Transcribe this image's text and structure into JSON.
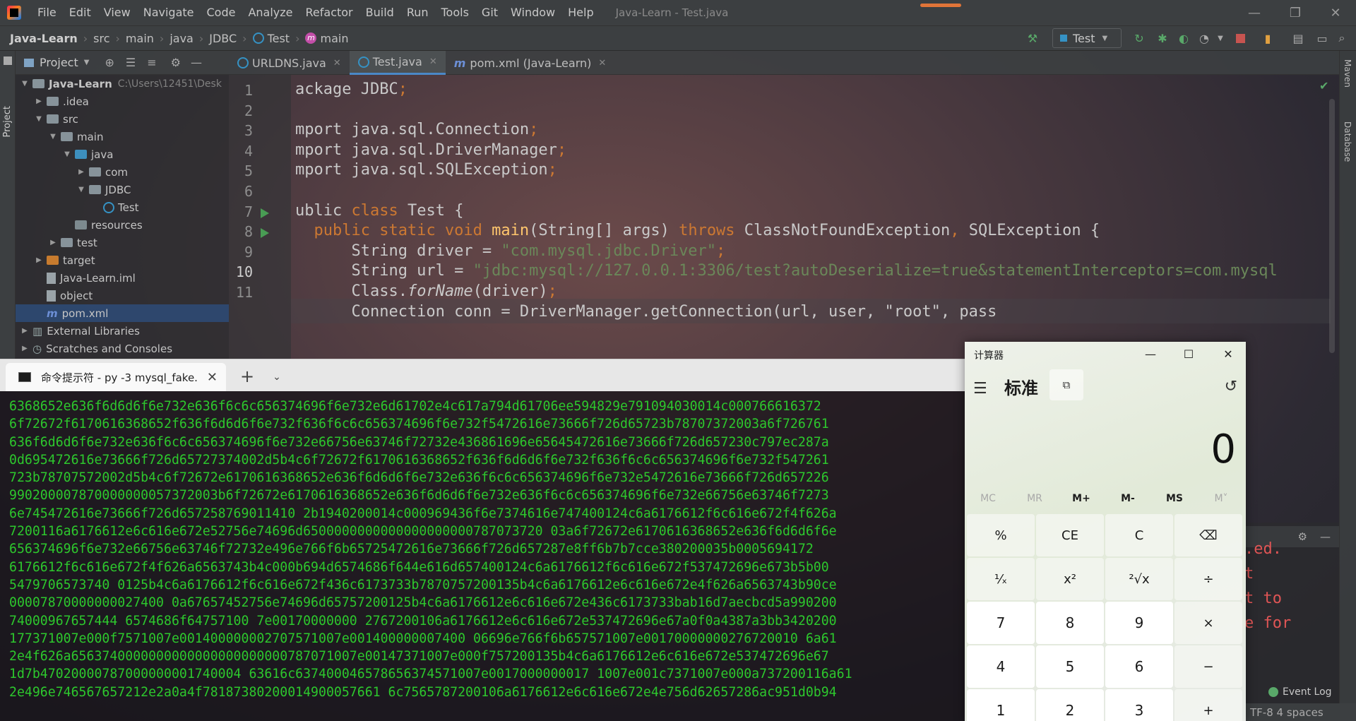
{
  "menubar": {
    "items": [
      "File",
      "Edit",
      "View",
      "Navigate",
      "Code",
      "Analyze",
      "Refactor",
      "Build",
      "Run",
      "Tools",
      "Git",
      "Window",
      "Help"
    ],
    "window_title": "Java-Learn - Test.java"
  },
  "breadcrumb": {
    "project": "Java-Learn",
    "parts": [
      "src",
      "main",
      "java",
      "JDBC"
    ],
    "class_name": "Test",
    "method": "main"
  },
  "run_config": {
    "label": "Test"
  },
  "project_panel": {
    "title": "Project",
    "tree": [
      {
        "label": "Java-Learn",
        "extra": "C:\\Users\\12451\\Desk",
        "indent": 0,
        "arrow": "down",
        "icon": "folder"
      },
      {
        "label": ".idea",
        "extra": "",
        "indent": 1,
        "arrow": "right",
        "icon": "folder"
      },
      {
        "label": "src",
        "extra": "",
        "indent": 1,
        "arrow": "down",
        "icon": "folder"
      },
      {
        "label": "main",
        "extra": "",
        "indent": 2,
        "arrow": "down",
        "icon": "folder"
      },
      {
        "label": "java",
        "extra": "",
        "indent": 3,
        "arrow": "down",
        "icon": "folder-blue"
      },
      {
        "label": "com",
        "extra": "",
        "indent": 4,
        "arrow": "right",
        "icon": "folder"
      },
      {
        "label": "JDBC",
        "extra": "",
        "indent": 4,
        "arrow": "down",
        "icon": "folder"
      },
      {
        "label": "Test",
        "extra": "",
        "indent": 5,
        "arrow": "",
        "icon": "class"
      },
      {
        "label": "resources",
        "extra": "",
        "indent": 3,
        "arrow": "",
        "icon": "folder-gray"
      },
      {
        "label": "test",
        "extra": "",
        "indent": 2,
        "arrow": "right",
        "icon": "folder"
      },
      {
        "label": "target",
        "extra": "",
        "indent": 1,
        "arrow": "right",
        "icon": "folder-orange"
      },
      {
        "label": "Java-Learn.iml",
        "extra": "",
        "indent": 1,
        "arrow": "",
        "icon": "file"
      },
      {
        "label": "object",
        "extra": "",
        "indent": 1,
        "arrow": "",
        "icon": "file"
      },
      {
        "label": "pom.xml",
        "extra": "",
        "indent": 1,
        "arrow": "",
        "icon": "maven",
        "selected": true
      },
      {
        "label": "External Libraries",
        "extra": "",
        "indent": 0,
        "arrow": "right",
        "icon": "lib"
      },
      {
        "label": "Scratches and Consoles",
        "extra": "",
        "indent": 0,
        "arrow": "right",
        "icon": "scratch"
      }
    ]
  },
  "editor": {
    "tabs": [
      {
        "label": "URLDNS.java",
        "active": false
      },
      {
        "label": "Test.java",
        "active": true
      },
      {
        "label": "pom.xml (Java-Learn)",
        "active": false
      }
    ],
    "current_line": 10,
    "lines": [
      {
        "n": "1",
        "html": "ackage JDBC<span class='kw'>;</span>"
      },
      {
        "n": "2",
        "html": ""
      },
      {
        "n": "3",
        "html": "mport java.sql.Connection<span class='kw'>;</span>"
      },
      {
        "n": "4",
        "html": "mport java.sql.DriverManager<span class='kw'>;</span>"
      },
      {
        "n": "5",
        "html": "mport java.sql.SQLException<span class='kw'>;</span>"
      },
      {
        "n": "6",
        "html": ""
      },
      {
        "n": "7",
        "html": "ublic <span class='kw'>class</span> Test {"
      },
      {
        "n": "8",
        "html": "  <span class='kw'>public static void</span> <span class='fn'>main</span>(String[] args) <span class='kw'>throws</span> ClassNotFoundException<span class='kw'>,</span> SQLException {"
      },
      {
        "n": "9",
        "html": "      String driver = <span class='str'>\"com.mysql.jdbc.Driver\"</span><span class='kw'>;</span>"
      },
      {
        "n": "10",
        "html": "      String url = <span class='str'>\"jdbc:mysql://127.0.0.1:3306/test?autoDeserialize=true&amp;statementInterceptors=com.mysql</span>"
      },
      {
        "n": "11",
        "html": "      Class.<span class='it'>forName</span>(driver)<span class='kw'>;</span>"
      },
      {
        "n": "",
        "html": "      Connection conn = DriverManager.getConnection(url, user, \"root\", pass"
      }
    ]
  },
  "side_labels": {
    "project": "Project",
    "maven": "Maven",
    "database": "Database"
  },
  "terminal": {
    "tab_title": "命令提示符 - py  -3 mysql_fake.",
    "lines": [
      "6368652e636f6d6d6f6e732e636f6c6c656374696f6e732e6d61702e4c617a794d61706ee594829e791094030014c000766616372",
      "6f72672f6170616368652f636f6d6d6f6e732f636f6c6c656374696f6e732f5472616e73666f726d65723b78707372003a6f726761",
      "636f6d6d6f6e732e636f6c6c656374696f6e732e66756e63746f72732e436861696e65645472616e73666f726d657230c797ec287a",
      "0d695472616e73666f726d65727374002d5b4c6f72672f6170616368652f636f6d6d6f6e732f636f6c6c656374696f6e732f547261",
      "723b78707572002d5b4c6f72672e6170616368652e636f6d6d6f6e732e636f6c6c656374696f6e732e5472616e73666f726d657226",
      "990200007870000000057372003b6f72672e6170616368652e636f6d6d6f6e732e636f6c6c656374696f6e732e66756e63746f7273",
      "6e745472616e73666f726d657258769011410 2b1940200014c000969436f6e7374616e747400124c6a6176612f6c616e672f4f626a",
      "7200116a6176612e6c616e672e52756e74696d6500000000000000000000787073720 03a6f72672e6170616368652e636f6d6d6f6e",
      "656374696f6e732e66756e63746f72732e496e766f6b65725472616e73666f726d657287e8ff6b7b7cce380200035b0005694172",
      "6176612f6c616e672f4f626a6563743b4c000b694d6574686f644e616d657400124c6a6176612f6c616e672f537472696e673b5b00",
      "5479706573740 0125b4c6a6176612f6c616e672f436c6173733b7870757200135b4c6a6176612e6c616e672e4f626a6563743b90ce",
      "00007870000000027400 0a67657452756e74696d65757200125b4c6a6176612e6c616e672e436c6173733bab16d7aecbcd5a990200",
      "74000967657444 6574686f64757100 7e00170000000 2767200106a6176612e6c616e672e537472696e67a0f0a4387a3bb3420200",
      "177371007e000f7571007e001400000002707571007e001400000007400 06696e766f6b657571007e00170000000276720010 6a61",
      "2e4f626a6563740000000000000000000000787071007e00147371007e000f757200135b4c6a6176612e6c616e672e537472696e67",
      "1d7b47020000787000000001740004 63616c637400046578656374571007e0017000000017 1007e001c7371007e000a737200116a61",
      "2e496e746567657212e2a0a4f78187380200014900057661 6c7565787200106a6176612e6c616e672e4e756d62657286ac951d0b94"
    ]
  },
  "ide_right": {
    "red_lines": [
      ".ed.",
      "t",
      "t to",
      "e for"
    ],
    "event_log": "Event Log",
    "status": "TF-8   4 spaces"
  },
  "calculator": {
    "title": "计算器",
    "mode": "标准",
    "display": "0",
    "memory": [
      {
        "label": "MC",
        "enabled": false
      },
      {
        "label": "MR",
        "enabled": false
      },
      {
        "label": "M+",
        "enabled": true
      },
      {
        "label": "M-",
        "enabled": true
      },
      {
        "label": "MS",
        "enabled": true
      },
      {
        "label": "M˅",
        "enabled": false
      }
    ],
    "keys": [
      {
        "label": "%",
        "num": false,
        "name": "percent-key"
      },
      {
        "label": "CE",
        "num": false,
        "name": "clear-entry-key"
      },
      {
        "label": "C",
        "num": false,
        "name": "clear-key"
      },
      {
        "label": "⌫",
        "num": false,
        "name": "backspace-key"
      },
      {
        "label": "¹⁄ₓ",
        "num": false,
        "name": "reciprocal-key"
      },
      {
        "label": "x²",
        "num": false,
        "name": "square-key"
      },
      {
        "label": "²√x",
        "num": false,
        "name": "sqrt-key"
      },
      {
        "label": "÷",
        "num": false,
        "name": "divide-key"
      },
      {
        "label": "7",
        "num": true,
        "name": "digit-7-key"
      },
      {
        "label": "8",
        "num": true,
        "name": "digit-8-key"
      },
      {
        "label": "9",
        "num": true,
        "name": "digit-9-key"
      },
      {
        "label": "×",
        "num": false,
        "name": "multiply-key"
      },
      {
        "label": "4",
        "num": true,
        "name": "digit-4-key"
      },
      {
        "label": "5",
        "num": true,
        "name": "digit-5-key"
      },
      {
        "label": "6",
        "num": true,
        "name": "digit-6-key"
      },
      {
        "label": "−",
        "num": false,
        "name": "subtract-key"
      },
      {
        "label": "1",
        "num": true,
        "name": "digit-1-key"
      },
      {
        "label": "2",
        "num": true,
        "name": "digit-2-key"
      },
      {
        "label": "3",
        "num": true,
        "name": "digit-3-key"
      },
      {
        "label": "+",
        "num": false,
        "name": "add-key"
      }
    ]
  }
}
